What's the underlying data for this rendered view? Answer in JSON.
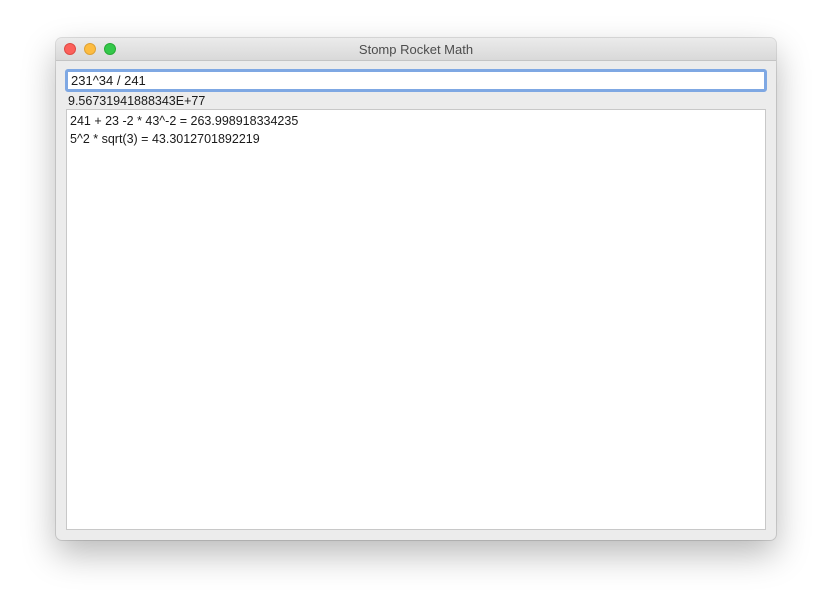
{
  "window": {
    "title": "Stomp Rocket Math",
    "controls": [
      {
        "name": "close",
        "color": "#fc605b"
      },
      {
        "name": "minimize",
        "color": "#fdbc40"
      },
      {
        "name": "zoom",
        "color": "#34c84a"
      }
    ]
  },
  "input": {
    "value": "231^34 / 241"
  },
  "result": {
    "text": "9.56731941888343E+77"
  },
  "history": [
    "241 + 23 -2 * 43^-2 = 263.998918334235",
    "5^2 * sqrt(3) = 43.3012701892219"
  ]
}
